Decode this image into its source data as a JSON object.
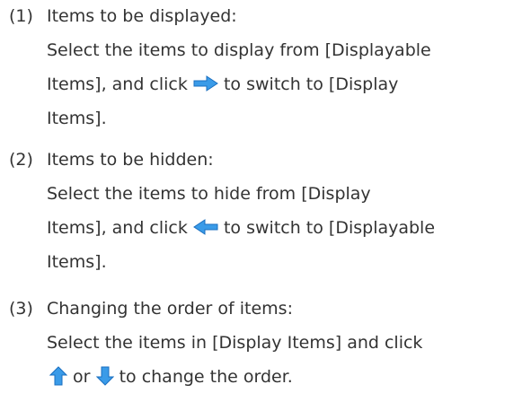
{
  "items": [
    {
      "number": "(1)",
      "heading": "Items to be displayed:",
      "line1": "Select the items to display from [Displayable",
      "line2_pre": "Items], and click",
      "line2_icon": "right-arrow-icon",
      "line2_post": "to switch to [Display",
      "line3": "Items]."
    },
    {
      "number": "(2)",
      "heading": "Items to be hidden:",
      "line1": "Select the items to hide from [Display",
      "line2_pre": "Items], and click",
      "line2_icon": "left-arrow-icon",
      "line2_post": "to switch to [Displayable",
      "line3": "Items]."
    },
    {
      "number": "(3)",
      "heading": "Changing the order of items:",
      "line1": "Select the items in [Display Items] and click",
      "line2_icon_a": "up-arrow-icon",
      "line2_mid": "or",
      "line2_icon_b": "down-arrow-icon",
      "line2_post": "to change the order."
    }
  ],
  "colors": {
    "text": "#333333",
    "arrow_fill": "#3a9be8",
    "arrow_stroke": "#1a6fc0"
  }
}
